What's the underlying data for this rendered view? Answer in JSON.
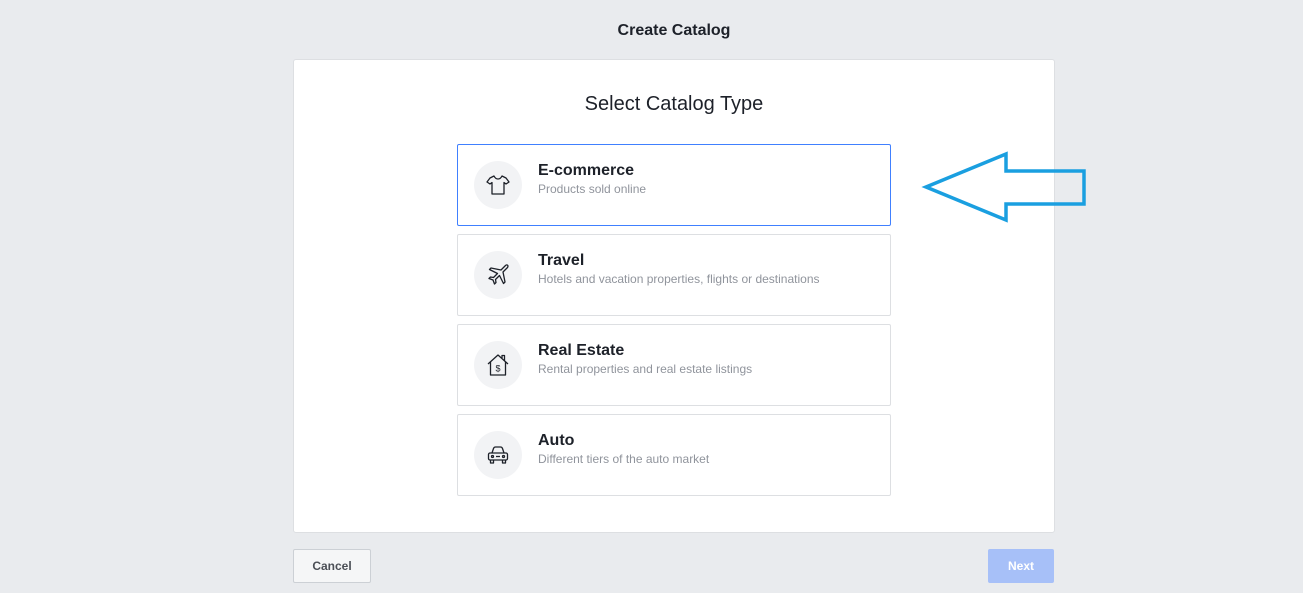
{
  "header": {
    "title": "Create Catalog"
  },
  "main": {
    "heading": "Select Catalog Type",
    "options": [
      {
        "title": "E-commerce",
        "description": "Products sold online",
        "icon": "tshirt-icon",
        "selected": true
      },
      {
        "title": "Travel",
        "description": "Hotels and vacation properties, flights or destinations",
        "icon": "airplane-icon",
        "selected": false
      },
      {
        "title": "Real Estate",
        "description": "Rental properties and real estate listings",
        "icon": "house-dollar-icon",
        "selected": false
      },
      {
        "title": "Auto",
        "description": "Different tiers of the auto market",
        "icon": "car-icon",
        "selected": false
      }
    ]
  },
  "footer": {
    "cancel_label": "Cancel",
    "next_label": "Next"
  },
  "colors": {
    "background": "#e9ebee",
    "selected_border": "#4080ff",
    "next_disabled": "#a7c0f8",
    "annotation_arrow": "#1a9fe0"
  }
}
